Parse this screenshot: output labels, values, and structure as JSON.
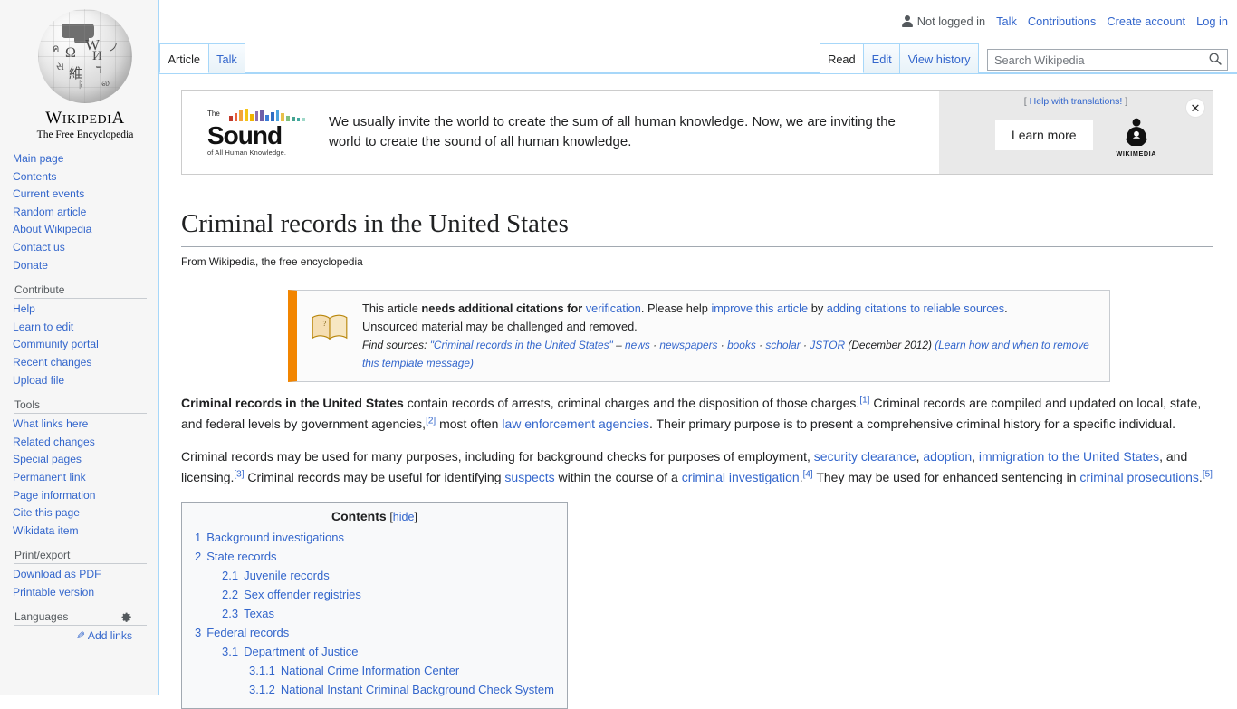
{
  "personal_bar": {
    "status": "Not logged in",
    "links": [
      "Talk",
      "Contributions",
      "Create account",
      "Log in"
    ]
  },
  "logo": {
    "wordmark_w": "W",
    "wordmark_rest": "IKIPEDI",
    "wordmark_a": "A",
    "tagline": "The Free Encyclopedia",
    "globe_glyphs": [
      "W",
      "Ω",
      "И",
      "維",
      "ד",
      "ค",
      "ノ",
      "સ",
      "ᚱ",
      "ல"
    ]
  },
  "sidebar": {
    "navigation": {
      "items": [
        "Main page",
        "Contents",
        "Current events",
        "Random article",
        "About Wikipedia",
        "Contact us",
        "Donate"
      ]
    },
    "contribute": {
      "heading": "Contribute",
      "items": [
        "Help",
        "Learn to edit",
        "Community portal",
        "Recent changes",
        "Upload file"
      ]
    },
    "tools": {
      "heading": "Tools",
      "items": [
        "What links here",
        "Related changes",
        "Special pages",
        "Permanent link",
        "Page information",
        "Cite this page",
        "Wikidata item"
      ]
    },
    "print_export": {
      "heading": "Print/export",
      "items": [
        "Download as PDF",
        "Printable version"
      ]
    },
    "languages": {
      "heading": "Languages",
      "add_links": "Add links"
    }
  },
  "tabs": {
    "namespaces": [
      {
        "label": "Article",
        "selected": true
      },
      {
        "label": "Talk",
        "selected": false
      }
    ],
    "views": [
      {
        "label": "Read",
        "selected": true
      },
      {
        "label": "Edit",
        "selected": false
      },
      {
        "label": "View history",
        "selected": false
      }
    ]
  },
  "search": {
    "placeholder": "Search Wikipedia",
    "value": "",
    "icon": "search-icon"
  },
  "banner": {
    "logo_the": "The",
    "logo_word": "Sound",
    "logo_sub": "of All Human Knowledge.",
    "message": "We usually invite the world to create the sum of all human knowledge. Now, we are inviting the world to create the sound of all human knowledge.",
    "help_translations": "Help with translations!",
    "bracket_open": "[",
    "bracket_close": "]",
    "learn_more": "Learn more",
    "wikimedia_label": "WIKIMEDIA",
    "close_glyph": "✕",
    "bar_colors": [
      "#c0392b",
      "#e8603c",
      "#f2a33c",
      "#f5c518",
      "#f0b400",
      "#8e6fb0",
      "#6f5fa8",
      "#3b7dd8",
      "#2f6fc4",
      "#4aa3df",
      "#e8c04a",
      "#7fbf7f",
      "#46a390",
      "#3fa9a0",
      "#9fd8c8"
    ]
  },
  "article": {
    "title": "Criminal records in the United States",
    "sitesub": "From Wikipedia, the free encyclopedia",
    "ambox": {
      "lead_1": "This article ",
      "bold": "needs additional citations for ",
      "link_verification": "verification",
      "lead_2": ". Please help ",
      "link_improve": "improve this article",
      "lead_3": " by ",
      "link_adding": "adding citations to reliable sources",
      "lead_4": ".",
      "line2": "Unsourced material may be challenged and removed.",
      "find_label": "Find sources:",
      "find_query": "\"Criminal records in the United States\"",
      "dash": "–",
      "find_links": [
        "news",
        "newspapers",
        "books",
        "scholar",
        "JSTOR"
      ],
      "date": "(December 2012)",
      "remove_note": "(Learn how and when to remove this template message)"
    },
    "paragraphs": [
      {
        "parts": [
          {
            "t": "Criminal records in the United States",
            "s": "bold"
          },
          {
            "t": " contain records of arrests, criminal charges and the disposition of those charges.",
            "s": "plain"
          },
          {
            "t": "[1]",
            "s": "ref"
          },
          {
            "t": " Criminal records are compiled and updated on local, state, and federal levels by government agencies,",
            "s": "plain"
          },
          {
            "t": "[2]",
            "s": "ref"
          },
          {
            "t": " most often ",
            "s": "plain"
          },
          {
            "t": "law enforcement agencies",
            "s": "link"
          },
          {
            "t": ". Their primary purpose is to present a comprehensive criminal history for a specific individual.",
            "s": "plain"
          }
        ]
      },
      {
        "parts": [
          {
            "t": "Criminal records may be used for many purposes, including for background checks for purposes of employment, ",
            "s": "plain"
          },
          {
            "t": "security clearance",
            "s": "link"
          },
          {
            "t": ", ",
            "s": "plain"
          },
          {
            "t": "adoption",
            "s": "link"
          },
          {
            "t": ", ",
            "s": "plain"
          },
          {
            "t": "immigration to the United States",
            "s": "link"
          },
          {
            "t": ", and licensing.",
            "s": "plain"
          },
          {
            "t": "[3]",
            "s": "ref"
          },
          {
            "t": " Criminal records may be useful for identifying ",
            "s": "plain"
          },
          {
            "t": "suspects",
            "s": "link"
          },
          {
            "t": " within the course of a ",
            "s": "plain"
          },
          {
            "t": "criminal investigation",
            "s": "link"
          },
          {
            "t": ".",
            "s": "plain"
          },
          {
            "t": "[4]",
            "s": "ref"
          },
          {
            "t": " They may be used for enhanced sentencing in ",
            "s": "plain"
          },
          {
            "t": "criminal prosecutions",
            "s": "link"
          },
          {
            "t": ".",
            "s": "plain"
          },
          {
            "t": "[5]",
            "s": "ref"
          }
        ]
      }
    ]
  },
  "toc": {
    "title": "Contents",
    "toggle_open": "[",
    "toggle_label": "hide",
    "toggle_close": "]",
    "entries": [
      {
        "num": "1",
        "text": "Background investigations",
        "level": 1
      },
      {
        "num": "2",
        "text": "State records",
        "level": 1
      },
      {
        "num": "2.1",
        "text": "Juvenile records",
        "level": 2
      },
      {
        "num": "2.2",
        "text": "Sex offender registries",
        "level": 2
      },
      {
        "num": "2.3",
        "text": "Texas",
        "level": 2
      },
      {
        "num": "3",
        "text": "Federal records",
        "level": 1
      },
      {
        "num": "3.1",
        "text": "Department of Justice",
        "level": 2
      },
      {
        "num": "3.1.1",
        "text": "National Crime Information Center",
        "level": 3
      },
      {
        "num": "3.1.2",
        "text": "National Instant Criminal Background Check System",
        "level": 3
      }
    ]
  }
}
